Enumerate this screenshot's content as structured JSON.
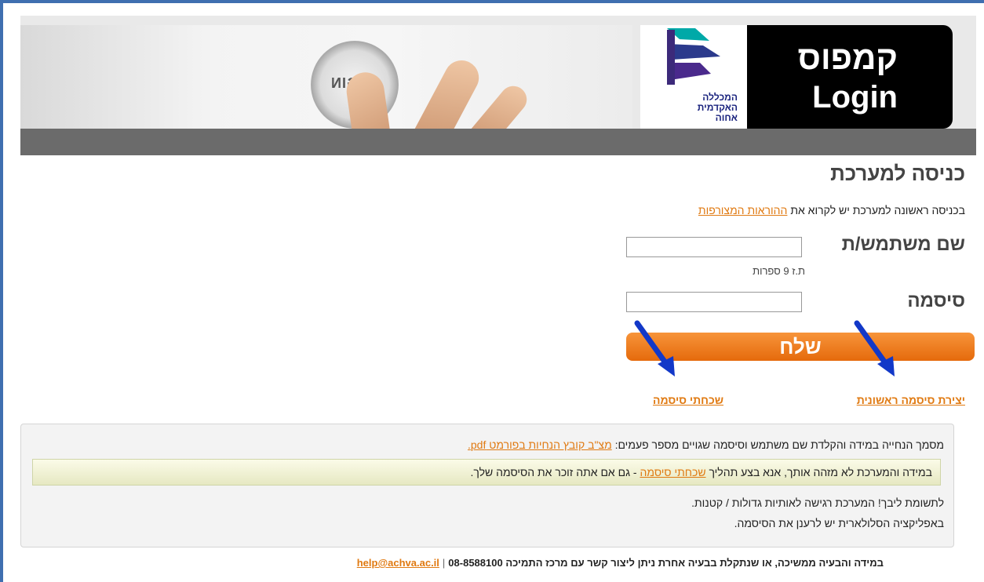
{
  "header": {
    "login_button_text": "LOGIN",
    "college_name_line1": "המכללה",
    "college_name_line2": "האקדמית",
    "college_name_line3": "אחוה",
    "campus_title": "קמפוס",
    "campus_subtitle": "Login"
  },
  "login": {
    "title": "כניסה למערכת",
    "intro_text": "בכניסה ראשונה למערכת יש לקרוא את",
    "intro_link": "ההוראות המצורפות",
    "username_label": "שם משתמש/ת",
    "username_value": "",
    "username_hint": "ת.ז 9 ספרות",
    "password_label": "סיסמה",
    "password_value": "",
    "submit_label": "שלח",
    "forgot_password_link": "שכחתי סיסמה",
    "create_password_link": "יצירת סיסמה ראשונית"
  },
  "notice": {
    "guide_text": "מסמך הנחייה במידה והקלדת שם משתמש וסיסמה שגויים מספר פעמים:",
    "guide_link": "מצ\"ב קובץ הנחיות בפורמט pdf.",
    "highlight_prefix": "במידה והמערכת לא מזהה אותך, אנא בצע תהליך",
    "highlight_link": "שכחתי סיסמה",
    "highlight_suffix": "- גם אם אתה זוכר את הסיסמה שלך.",
    "case_sensitive_note": "לתשומת ליבך! המערכת רגישה לאותיות גדולות / קטנות.",
    "mobile_note": "באפליקציה הסלולארית יש לרענן את הסיסמה."
  },
  "footer": {
    "support_text": "במידה והבעיה ממשיכה, או שנתקלת בבעיה אחרת ניתן ליצור קשר עם מרכז התמיכה",
    "phone": "08-8588100",
    "email": "help@achva.ac.il"
  },
  "colors": {
    "accent_orange": "#e56a0c",
    "link_orange": "#e07a12",
    "arrow_blue": "#1238c8",
    "frame_blue": "#3f6fb0"
  }
}
